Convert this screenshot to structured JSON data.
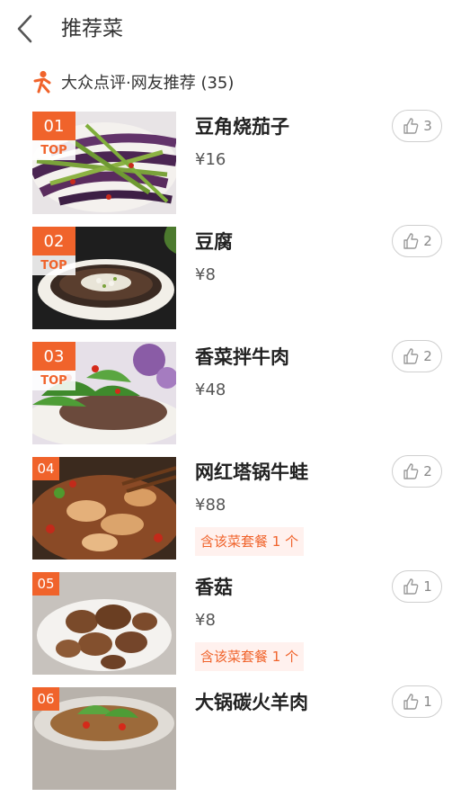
{
  "header": {
    "title": "推荐菜"
  },
  "source": {
    "label": "大众点评·网友推荐 (35)"
  },
  "colors": {
    "accent": "#f0632b",
    "tag_bg": "#fff1ee"
  },
  "dishes": [
    {
      "rank": "01",
      "top": "TOP",
      "name": "豆角烧茄子",
      "price": "¥16",
      "likes": "3"
    },
    {
      "rank": "02",
      "top": "TOP",
      "name": "豆腐",
      "price": "¥8",
      "likes": "2"
    },
    {
      "rank": "03",
      "top": "TOP",
      "name": "香菜拌牛肉",
      "price": "¥48",
      "likes": "2"
    },
    {
      "rank": "04",
      "name": "网红塔锅牛蛙",
      "price": "¥88",
      "meal": "含该菜套餐 1 个",
      "likes": "2"
    },
    {
      "rank": "05",
      "name": "香菇",
      "price": "¥8",
      "meal": "含该菜套餐 1 个",
      "likes": "1"
    },
    {
      "rank": "06",
      "name": "大锅碳火羊肉",
      "likes": "1"
    }
  ]
}
